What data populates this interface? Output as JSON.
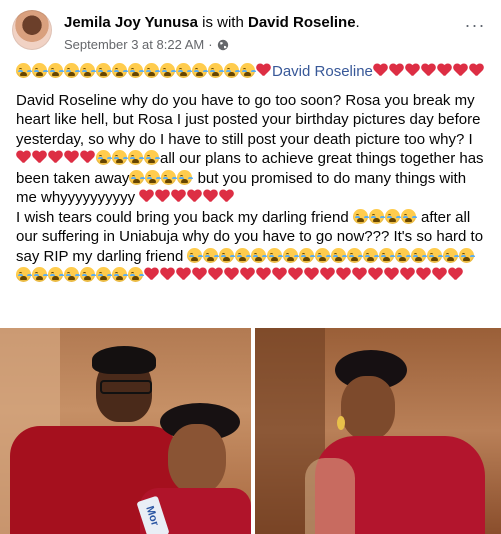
{
  "post": {
    "author": "Jemila Joy Yunusa",
    "with_text": "is with",
    "tagged": "David Roseline",
    "tagged_suffix": ".",
    "date": "September 3 at 8:22 AM",
    "separator": "·",
    "privacy_icon": "globe-icon",
    "more_icon": "more-options-icon",
    "more_label": "···",
    "line1_mention": "David Roseline",
    "para1_a": "David Roseline  why do you have to go too soon? Rosa you break my heart like hell, but Rosa I just posted your birthday pictures day before yesterday, so why do I have to still post your death picture too why? I",
    "para1_b": "all our plans to achieve great things together has been taken away",
    "para1_c": " but you promised to do many things with me whyyyyyyyyyy ",
    "para2_a": "I wish tears could bring you back my darling friend ",
    "para2_b": " after all our suffering in Uniabuja why do you have to go now??? It's so hard to say RIP my darling friend ",
    "emoji": {
      "cry": "crying-face-emoji",
      "heart": "broken-heart-emoji"
    }
  },
  "colors": {
    "link": "#385898",
    "meta": "#65676b",
    "heart": "#dd2e44",
    "face": "#ffcc4d"
  },
  "photos": [
    {
      "name": "left-photo",
      "banner_text": "Mor"
    },
    {
      "name": "right-photo"
    }
  ]
}
